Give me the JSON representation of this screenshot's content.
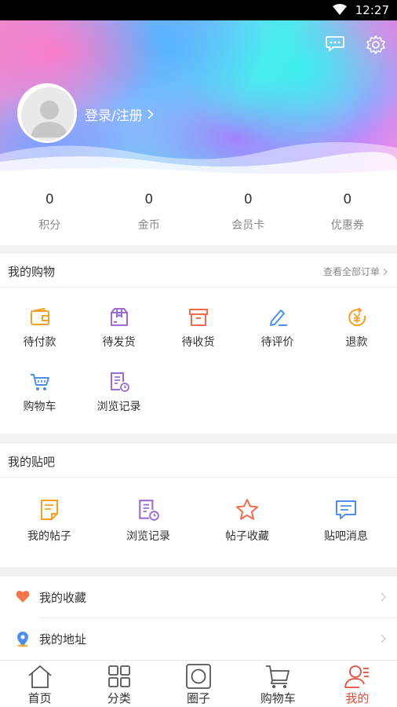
{
  "status_bar": {
    "time": "12:27"
  },
  "header": {
    "login_label": "登录/注册"
  },
  "stats": [
    {
      "value": "0",
      "label": "积分"
    },
    {
      "value": "0",
      "label": "金币"
    },
    {
      "value": "0",
      "label": "会员卡"
    },
    {
      "value": "0",
      "label": "优惠券"
    }
  ],
  "shopping": {
    "title": "我的购物",
    "view_all": "查看全部订单",
    "items": [
      {
        "label": "待付款",
        "icon": "wallet-icon"
      },
      {
        "label": "待发货",
        "icon": "package-icon"
      },
      {
        "label": "待收货",
        "icon": "box-icon"
      },
      {
        "label": "待评价",
        "icon": "pen-icon"
      },
      {
        "label": "退款",
        "icon": "yen-refund-icon"
      },
      {
        "label": "购物车",
        "icon": "cart-icon"
      },
      {
        "label": "浏览记录",
        "icon": "history-icon"
      }
    ]
  },
  "forum": {
    "title": "我的贴吧",
    "items": [
      {
        "label": "我的帖子",
        "icon": "post-icon"
      },
      {
        "label": "浏览记录",
        "icon": "history-icon"
      },
      {
        "label": "帖子收藏",
        "icon": "star-icon"
      },
      {
        "label": "贴吧消息",
        "icon": "message-icon"
      }
    ]
  },
  "list": [
    {
      "label": "我的收藏",
      "icon": "heart-icon"
    },
    {
      "label": "我的地址",
      "icon": "location-icon"
    }
  ],
  "tabbar": [
    {
      "label": "首页",
      "icon": "home-icon",
      "active": false
    },
    {
      "label": "分类",
      "icon": "grid-icon",
      "active": false
    },
    {
      "label": "圈子",
      "icon": "circle-icon",
      "active": false
    },
    {
      "label": "购物车",
      "icon": "cart-icon",
      "active": false
    },
    {
      "label": "我的",
      "icon": "user-icon",
      "active": true
    }
  ],
  "colors": {
    "accent_red": "#e64a3b",
    "orange": "#f2a024",
    "purple": "#9a6cd6",
    "blue": "#4d8fe8"
  }
}
